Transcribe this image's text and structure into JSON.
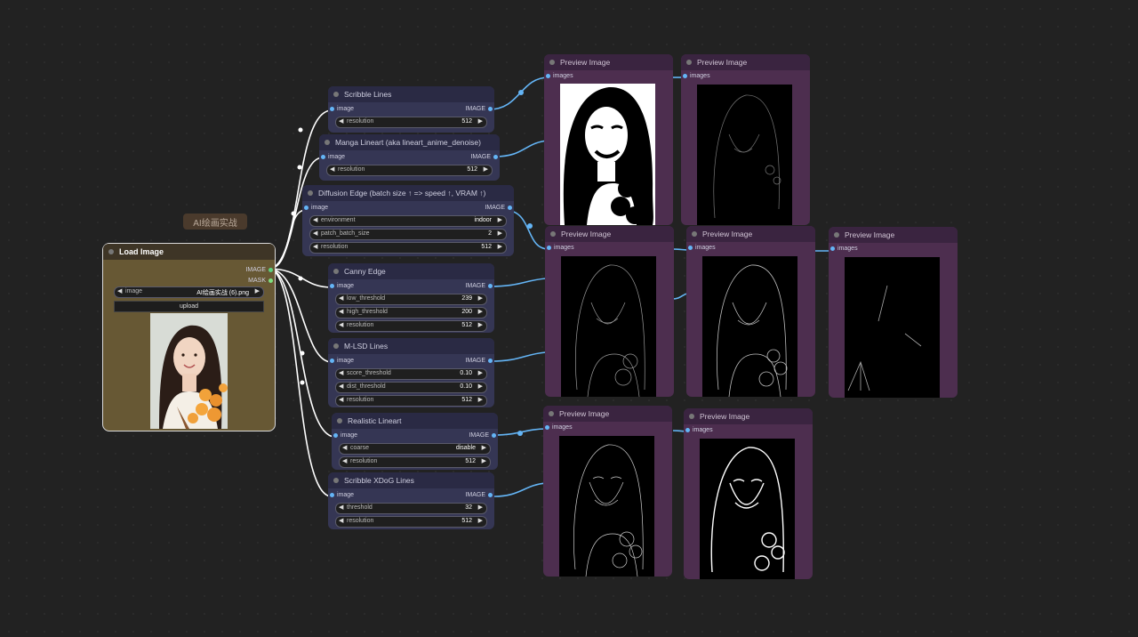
{
  "group_label": "AI绘画实战",
  "load_image": {
    "title": "Load Image",
    "outputs": [
      "IMAGE",
      "MASK"
    ],
    "image_widget": {
      "name": "image",
      "value": "AI绘画实战 (6).png"
    },
    "upload_label": "upload"
  },
  "nodes": {
    "scribble": {
      "title": "Scribble Lines",
      "input": "image",
      "output": "IMAGE",
      "widgets": [
        {
          "name": "resolution",
          "value": "512"
        }
      ]
    },
    "manga": {
      "title": "Manga Lineart (aka lineart_anime_denoise)",
      "input": "image",
      "output": "IMAGE",
      "widgets": [
        {
          "name": "resolution",
          "value": "512"
        }
      ]
    },
    "diffusion": {
      "title": "Diffusion Edge (batch size ↑ => speed ↑, VRAM ↑)",
      "input": "image",
      "output": "IMAGE",
      "widgets": [
        {
          "name": "environment",
          "value": "indoor"
        },
        {
          "name": "patch_batch_size",
          "value": "2"
        },
        {
          "name": "resolution",
          "value": "512"
        }
      ]
    },
    "canny": {
      "title": "Canny Edge",
      "input": "image",
      "output": "IMAGE",
      "widgets": [
        {
          "name": "low_threshold",
          "value": "239"
        },
        {
          "name": "high_threshold",
          "value": "200"
        },
        {
          "name": "resolution",
          "value": "512"
        }
      ]
    },
    "mlsd": {
      "title": "M-LSD Lines",
      "input": "image",
      "output": "IMAGE",
      "widgets": [
        {
          "name": "score_threshold",
          "value": "0.10"
        },
        {
          "name": "dist_threshold",
          "value": "0.10"
        },
        {
          "name": "resolution",
          "value": "512"
        }
      ]
    },
    "realistic": {
      "title": "Realistic Lineart",
      "input": "image",
      "output": "IMAGE",
      "widgets": [
        {
          "name": "coarse",
          "value": "disable"
        },
        {
          "name": "resolution",
          "value": "512"
        }
      ]
    },
    "xdog": {
      "title": "Scribble XDoG Lines",
      "input": "image",
      "output": "IMAGE",
      "widgets": [
        {
          "name": "threshold",
          "value": "32"
        },
        {
          "name": "resolution",
          "value": "512"
        }
      ]
    }
  },
  "preview": {
    "title": "Preview Image",
    "input": "images"
  },
  "colors": {
    "background": "#222222",
    "wire_image": "#64b5f6",
    "wire_white": "#ffffff",
    "preview_node": "#4d2e4f",
    "processor_node": "#353654",
    "load_node": "#675834"
  }
}
